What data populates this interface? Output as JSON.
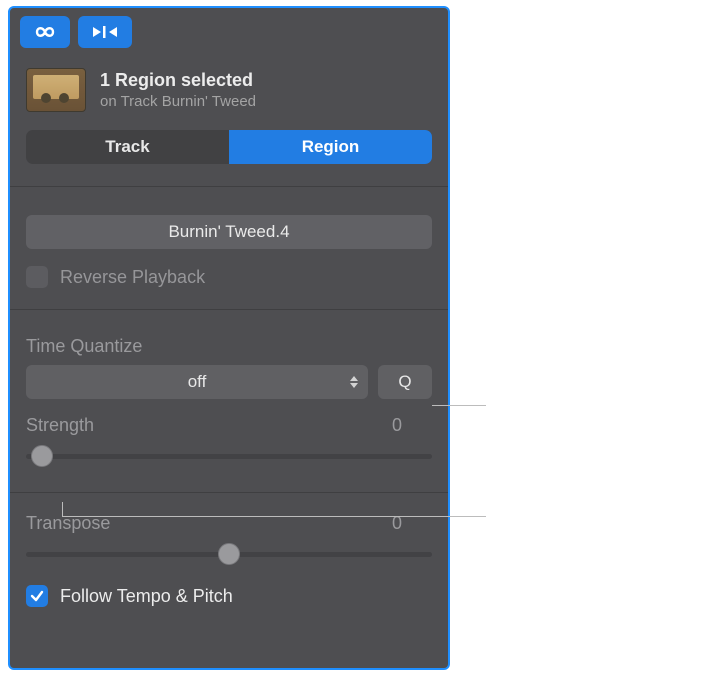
{
  "header": {
    "title": "1 Region selected",
    "subtitle": "on Track Burnin' Tweed"
  },
  "tabs": {
    "track": "Track",
    "region": "Region"
  },
  "region_name": "Burnin' Tweed.4",
  "reverse_playback": {
    "label": "Reverse Playback",
    "checked": false
  },
  "time_quantize": {
    "label": "Time Quantize",
    "value": "off",
    "q_button": "Q"
  },
  "strength": {
    "label": "Strength",
    "value": "0",
    "slider_pos_pct": 4
  },
  "transpose": {
    "label": "Transpose",
    "value": "0",
    "slider_pos_pct": 50
  },
  "follow_tempo_pitch": {
    "label": "Follow Tempo & Pitch",
    "checked": true
  }
}
